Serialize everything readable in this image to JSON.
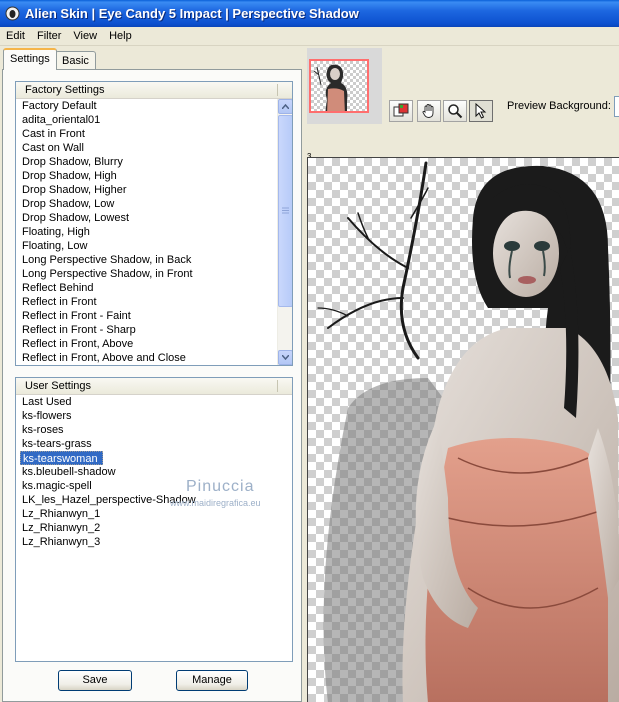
{
  "window": {
    "title": "Alien Skin  |  Eye Candy 5 Impact  |  Perspective Shadow"
  },
  "menu": [
    "Edit",
    "Filter",
    "View",
    "Help"
  ],
  "tabs": {
    "settings": "Settings",
    "basic": "Basic"
  },
  "factory_settings": {
    "header": "Factory Settings",
    "items": [
      "Factory Default",
      "adita_oriental01",
      "Cast in Front",
      "Cast on Wall",
      "Drop Shadow, Blurry",
      "Drop Shadow, High",
      "Drop Shadow, Higher",
      "Drop Shadow, Low",
      "Drop Shadow, Lowest",
      "Floating, High",
      "Floating, Low",
      "Long Perspective Shadow, in Back",
      "Long Perspective Shadow, in Front",
      "Reflect Behind",
      "Reflect in Front",
      "Reflect in Front - Faint",
      "Reflect in Front - Sharp",
      "Reflect in Front, Above",
      "Reflect in Front, Above and Close"
    ]
  },
  "user_settings": {
    "header": "User Settings",
    "items": [
      "Last Used",
      "ks-flowers",
      "ks-roses",
      "ks-tears-grass",
      "ks-tearswoman",
      "ks.bleubell-shadow",
      "ks.magic-spell",
      "LK_les_Hazel_perspective-Shadow",
      "Lz_Rhianwyn_1",
      "Lz_Rhianwyn_2",
      "Lz_Rhianwyn_3"
    ],
    "selected": "ks-tearswoman"
  },
  "buttons": {
    "save": "Save",
    "manage": "Manage"
  },
  "preview": {
    "background_label": "Preview Background:",
    "ruler_mark": "3"
  },
  "watermark": {
    "name": "Pinuccia",
    "site": "www.maidiregrafica.eu"
  },
  "colors": {
    "titlebar": "#0c50cf",
    "selection": "#316ac5",
    "thumb_border": "#ff6e6e"
  }
}
